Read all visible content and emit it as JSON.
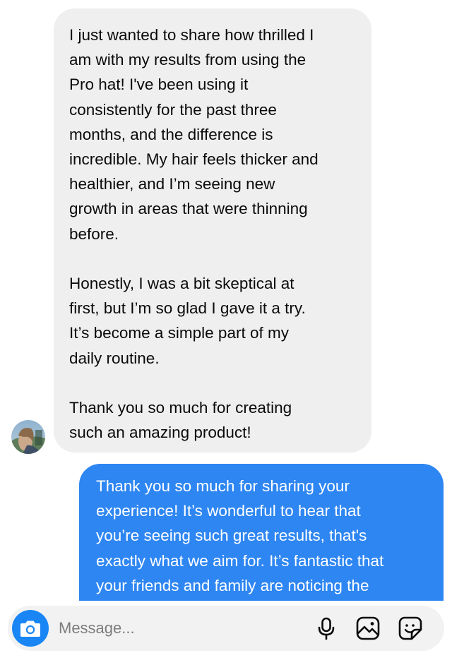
{
  "conversation": {
    "incoming": {
      "paragraphs": [
        "I just wanted to share how thrilled I\nam with my results from using the\nPro hat! I've been using it\nconsistently for the past three\nmonths, and the difference is\nincredible. My hair feels thicker and\nhealthier, and I’m seeing new\ngrowth in areas that were thinning\nbefore.",
        "Honestly, I was a bit skeptical at\nfirst, but I’m so glad I gave it a try.\nIt’s become a simple part of my\ndaily routine.",
        "Thank you so much for creating\nsuch an amazing product!"
      ]
    },
    "outgoing": {
      "text": "Thank you so much for sharing your\nexperience! It’s wonderful to hear that\nyou’re seeing such great results, that's\nexactly what we aim for. It’s fantastic that\nyour friends and family are noticing the"
    }
  },
  "composer": {
    "placeholder": "Message...",
    "icons": {
      "camera": "camera-icon",
      "microphone": "microphone-icon",
      "gallery": "gallery-icon",
      "sticker": "sticker-icon"
    }
  },
  "colors": {
    "incoming_bubble": "#efefef",
    "outgoing_bubble": "#2e86f2",
    "camera_button": "#1a86f5"
  }
}
